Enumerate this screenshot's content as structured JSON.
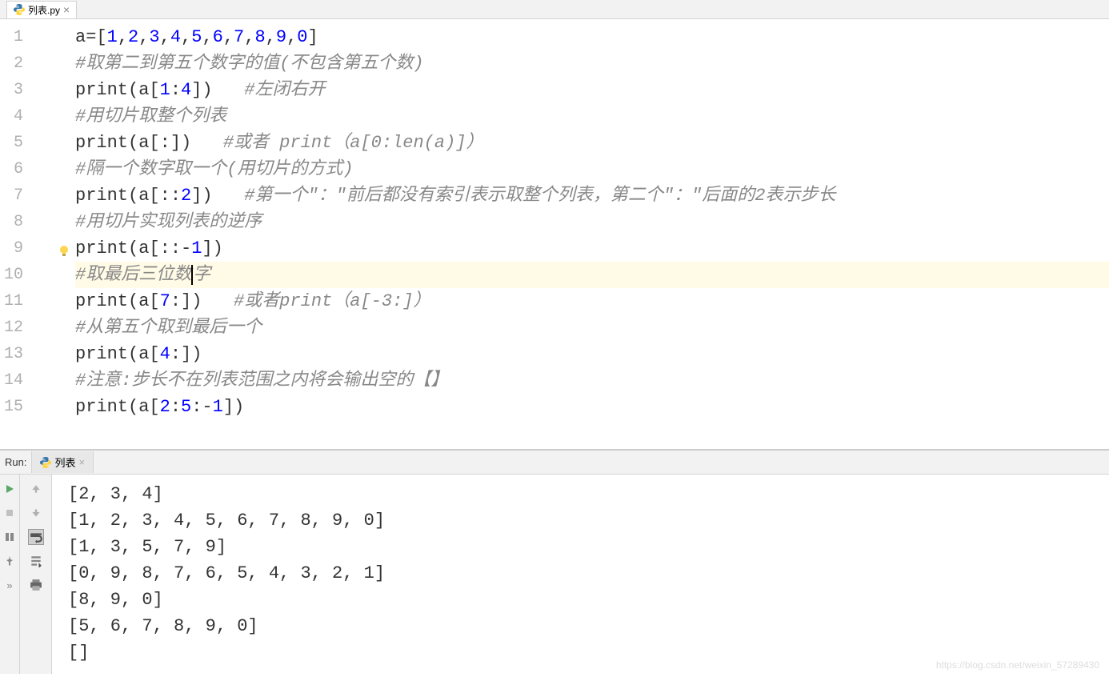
{
  "tabs": {
    "file": {
      "name": "列表.py"
    }
  },
  "editor": {
    "lines": [
      {
        "num": "1",
        "tokens": [
          {
            "t": "d",
            "v": "a=["
          },
          {
            "t": "n",
            "v": "1"
          },
          {
            "t": "d",
            "v": ","
          },
          {
            "t": "n",
            "v": "2"
          },
          {
            "t": "d",
            "v": ","
          },
          {
            "t": "n",
            "v": "3"
          },
          {
            "t": "d",
            "v": ","
          },
          {
            "t": "n",
            "v": "4"
          },
          {
            "t": "d",
            "v": ","
          },
          {
            "t": "n",
            "v": "5"
          },
          {
            "t": "d",
            "v": ","
          },
          {
            "t": "n",
            "v": "6"
          },
          {
            "t": "d",
            "v": ","
          },
          {
            "t": "n",
            "v": "7"
          },
          {
            "t": "d",
            "v": ","
          },
          {
            "t": "n",
            "v": "8"
          },
          {
            "t": "d",
            "v": ","
          },
          {
            "t": "n",
            "v": "9"
          },
          {
            "t": "d",
            "v": ","
          },
          {
            "t": "n",
            "v": "0"
          },
          {
            "t": "d",
            "v": "]"
          }
        ]
      },
      {
        "num": "2",
        "tokens": [
          {
            "t": "c",
            "v": "#取第二到第五个数字的值(不包含第五个数)"
          }
        ]
      },
      {
        "num": "3",
        "tokens": [
          {
            "t": "d",
            "v": "print(a["
          },
          {
            "t": "n",
            "v": "1"
          },
          {
            "t": "d",
            "v": ":"
          },
          {
            "t": "n",
            "v": "4"
          },
          {
            "t": "d",
            "v": "])   "
          },
          {
            "t": "c",
            "v": "#左闭右开"
          }
        ]
      },
      {
        "num": "4",
        "tokens": [
          {
            "t": "c",
            "v": "#用切片取整个列表"
          }
        ]
      },
      {
        "num": "5",
        "tokens": [
          {
            "t": "d",
            "v": "print(a[:])   "
          },
          {
            "t": "c",
            "v": "#或者 print（a[0:len(a)]）"
          }
        ]
      },
      {
        "num": "6",
        "tokens": [
          {
            "t": "c",
            "v": "#隔一个数字取一个(用切片的方式)"
          }
        ]
      },
      {
        "num": "7",
        "tokens": [
          {
            "t": "d",
            "v": "print(a[::"
          },
          {
            "t": "n",
            "v": "2"
          },
          {
            "t": "d",
            "v": "])   "
          },
          {
            "t": "c",
            "v": "#第一个\"：\"前后都没有索引表示取整个列表，第二个\"：\"后面的2表示步长"
          }
        ]
      },
      {
        "num": "8",
        "tokens": [
          {
            "t": "c",
            "v": "#用切片实现列表的逆序"
          }
        ]
      },
      {
        "num": "9",
        "bulb": true,
        "tokens": [
          {
            "t": "d",
            "v": "print(a[::-"
          },
          {
            "t": "n",
            "v": "1"
          },
          {
            "t": "d",
            "v": "])"
          }
        ]
      },
      {
        "num": "10",
        "highlighted": true,
        "caret": 7,
        "tokens": [
          {
            "t": "c",
            "v": "#取最后三位数字"
          }
        ]
      },
      {
        "num": "11",
        "tokens": [
          {
            "t": "d",
            "v": "print(a["
          },
          {
            "t": "n",
            "v": "7"
          },
          {
            "t": "d",
            "v": ":])   "
          },
          {
            "t": "c",
            "v": "#或者print（a[-3:]）"
          }
        ]
      },
      {
        "num": "12",
        "tokens": [
          {
            "t": "c",
            "v": "#从第五个取到最后一个"
          }
        ]
      },
      {
        "num": "13",
        "tokens": [
          {
            "t": "d",
            "v": "print(a["
          },
          {
            "t": "n",
            "v": "4"
          },
          {
            "t": "d",
            "v": ":])"
          }
        ]
      },
      {
        "num": "14",
        "tokens": [
          {
            "t": "c",
            "v": "#注意:步长不在列表范围之内将会输出空的【】"
          }
        ]
      },
      {
        "num": "15",
        "tokens": [
          {
            "t": "d",
            "v": "print(a["
          },
          {
            "t": "n",
            "v": "2"
          },
          {
            "t": "d",
            "v": ":"
          },
          {
            "t": "n",
            "v": "5"
          },
          {
            "t": "d",
            "v": ":-"
          },
          {
            "t": "n",
            "v": "1"
          },
          {
            "t": "d",
            "v": "])"
          }
        ]
      }
    ]
  },
  "run": {
    "label": "Run:",
    "tab_name": "列表",
    "output": [
      "[2, 3, 4]",
      "[1, 2, 3, 4, 5, 6, 7, 8, 9, 0]",
      "[1, 3, 5, 7, 9]",
      "[0, 9, 8, 7, 6, 5, 4, 3, 2, 1]",
      "[8, 9, 0]",
      "[5, 6, 7, 8, 9, 0]",
      "[]"
    ]
  },
  "watermark": "https://blog.csdn.net/weixin_57289430"
}
